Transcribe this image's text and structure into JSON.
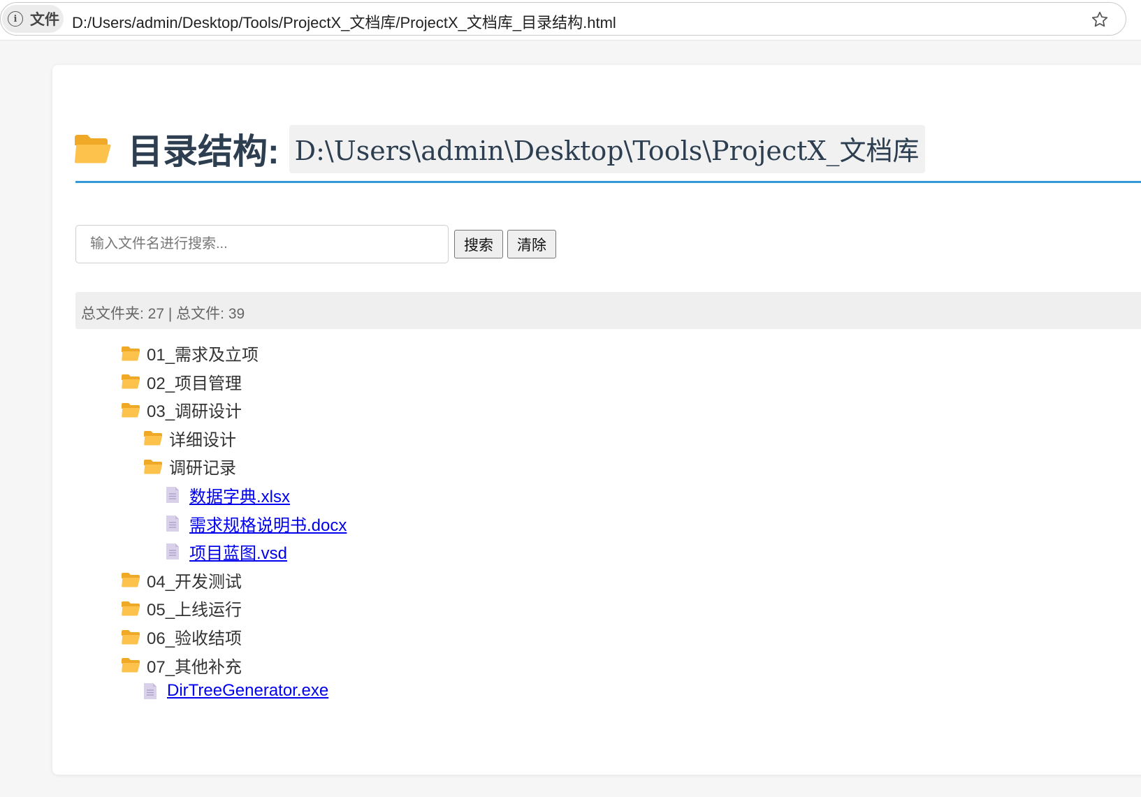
{
  "browser": {
    "info_label": "文件",
    "url": "D:/Users/admin/Desktop/Tools/ProjectX_文档库/ProjectX_文档库_目录结构.html"
  },
  "page": {
    "title_label": "目录结构:",
    "title_path": "D:\\Users\\admin\\Desktop\\Tools\\ProjectX_文档库",
    "search_placeholder": "输入文件名进行搜索...",
    "search_button": "搜索",
    "clear_button": "清除",
    "stats": "总文件夹: 27 | 总文件: 39"
  },
  "tree": [
    {
      "type": "folder",
      "level": 1,
      "name": "01_需求及立项"
    },
    {
      "type": "folder",
      "level": 1,
      "name": "02_项目管理"
    },
    {
      "type": "folder",
      "level": 1,
      "name": "03_调研设计"
    },
    {
      "type": "folder",
      "level": 2,
      "name": "详细设计"
    },
    {
      "type": "folder",
      "level": 2,
      "name": "调研记录"
    },
    {
      "type": "file",
      "level": 3,
      "name": "数据字典.xlsx"
    },
    {
      "type": "file",
      "level": 3,
      "name": "需求规格说明书.docx"
    },
    {
      "type": "file",
      "level": 3,
      "name": "项目蓝图.vsd"
    },
    {
      "type": "folder",
      "level": 1,
      "name": "04_开发测试"
    },
    {
      "type": "folder",
      "level": 1,
      "name": "05_上线运行"
    },
    {
      "type": "folder",
      "level": 1,
      "name": "06_验收结项"
    },
    {
      "type": "folder",
      "level": 1,
      "name": "07_其他补充"
    },
    {
      "type": "file",
      "level": 2,
      "name": "DirTreeGenerator.exe"
    }
  ],
  "colors": {
    "folder": "#fcc24c",
    "accent_rule": "#3498db",
    "link": "#0000ee",
    "file_icon": "#d9d0ea"
  }
}
